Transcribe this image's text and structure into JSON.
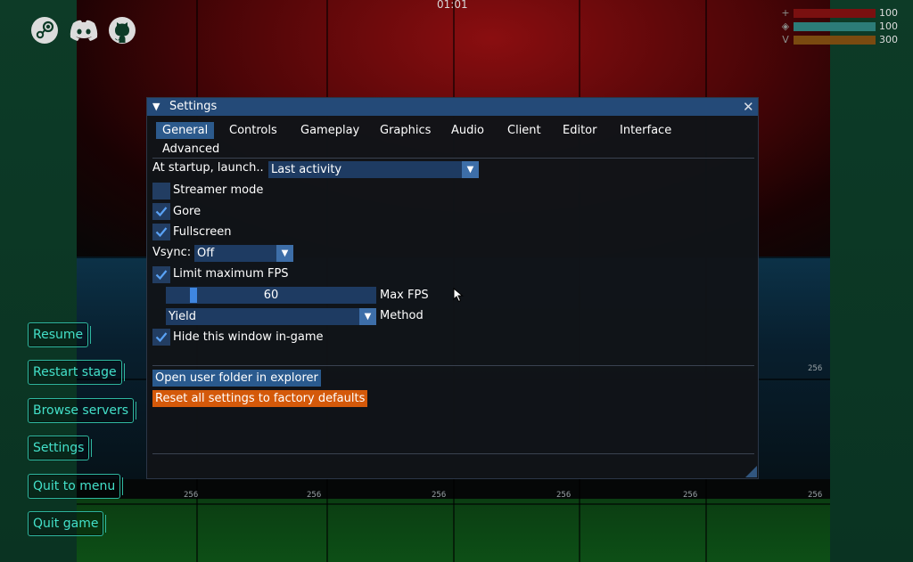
{
  "hud": {
    "timer": "01:01",
    "stats": [
      {
        "icon": "health-icon",
        "glyph": "+",
        "value": "100",
        "color": "#7a1010"
      },
      {
        "icon": "shield-icon",
        "glyph": "◈",
        "value": "100",
        "color": "#2c7c78"
      },
      {
        "icon": "armor-icon",
        "glyph": "V",
        "value": "300",
        "color": "#7a4a10"
      }
    ],
    "cell_numbers": [
      "256",
      "256",
      "256",
      "256",
      "256",
      "256",
      "256"
    ],
    "brand_icons": [
      "steam-icon",
      "discord-icon",
      "github-icon"
    ]
  },
  "game_menu": {
    "items": [
      "Resume",
      "Restart stage",
      "Browse servers",
      "Settings",
      "Quit to menu",
      "Quit game"
    ],
    "accent": "#43e0c9"
  },
  "settings": {
    "title": "Settings",
    "tabs": [
      "General",
      "Controls",
      "Gameplay",
      "Graphics",
      "Audio",
      "Client",
      "Editor",
      "Interface",
      "Advanced"
    ],
    "active_tab": "General",
    "startup_label": "At startup, launch..",
    "startup_value": "Last activity",
    "streamer_mode": {
      "label": "Streamer mode",
      "checked": false
    },
    "gore": {
      "label": "Gore",
      "checked": true
    },
    "fullscreen": {
      "label": "Fullscreen",
      "checked": true
    },
    "vsync_label": "Vsync:",
    "vsync_value": "Off",
    "limit_fps": {
      "label": "Limit maximum FPS",
      "checked": true
    },
    "max_fps": {
      "value": "60",
      "label": "Max FPS",
      "fraction": 0.15
    },
    "method": {
      "value": "Yield",
      "label": "Method"
    },
    "hide_window": {
      "label": "Hide this window in-game",
      "checked": true
    },
    "open_folder_label": "Open user folder in explorer",
    "reset_label": "Reset all settings to factory defaults",
    "colors": {
      "title_bar": "#244a78",
      "active_tab": "#2c5a8c",
      "reset": "#d4590a"
    }
  }
}
